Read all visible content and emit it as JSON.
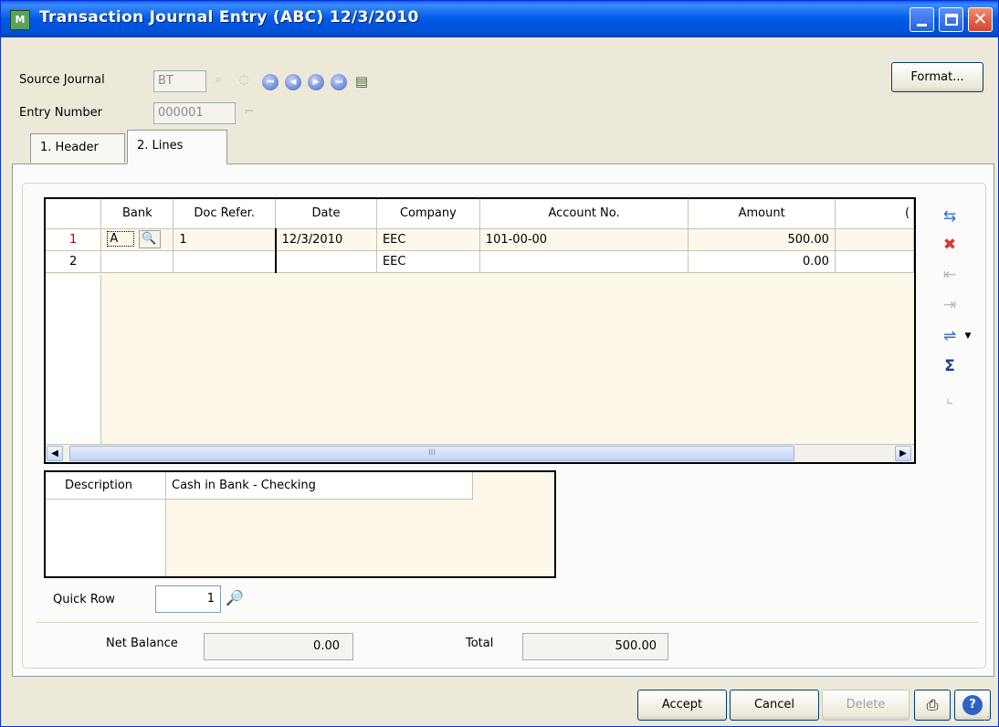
{
  "window": {
    "app_icon_text": "M",
    "title": "Transaction Journal Entry (ABC) 12/3/2010",
    "controls": {
      "minimize": "minimize",
      "maximize": "maximize",
      "close": "✕"
    }
  },
  "header": {
    "source_journal_label": "Source Journal",
    "source_journal_value": "BT",
    "entry_number_label": "Entry Number",
    "entry_number_value": "000001",
    "format_button": "Format..."
  },
  "tabs": [
    {
      "label": "1. Header",
      "active": false
    },
    {
      "label": "2. Lines",
      "active": true
    }
  ],
  "grid": {
    "columns": [
      "Bank",
      "Doc Refer.",
      "Date",
      "Company",
      "Account No.",
      "Amount"
    ],
    "rows": [
      {
        "num": "1",
        "bank": "A",
        "doc_ref": "1",
        "date": "12/3/2010",
        "company": "EEC",
        "account": "101-00-00",
        "amount": "500.00"
      },
      {
        "num": "2",
        "bank": "",
        "doc_ref": "",
        "date": "",
        "company": "EEC",
        "account": "",
        "amount": "0.00"
      }
    ],
    "scroll_thumb_grip": "III"
  },
  "description": {
    "label": "Description",
    "value": "Cash in Bank - Checking"
  },
  "quick_row": {
    "label": "Quick Row",
    "value": "1"
  },
  "totals": {
    "net_balance_label": "Net Balance",
    "net_balance_value": "0.00",
    "total_label": "Total",
    "total_value": "500.00"
  },
  "footer": {
    "accept": "Accept",
    "cancel": "Cancel",
    "delete": "Delete",
    "help_glyph": "?"
  },
  "icons": {
    "source_journal_lookup": "lookup-icon",
    "navigation": [
      "first-record-icon",
      "previous-record-icon",
      "next-record-icon",
      "last-record-icon",
      "memo-icon"
    ],
    "grid_tools": [
      "insert-row-icon",
      "delete-row-icon",
      "indent-icon",
      "outdent-icon",
      "copy-row-icon",
      "sum-icon",
      "expand-icon"
    ]
  },
  "colors": {
    "title_bar": "#0058e6",
    "grid_background": "#fdf8ea",
    "current_row_number": "#c00000"
  }
}
